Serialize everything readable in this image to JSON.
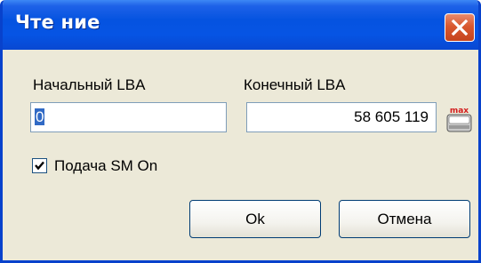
{
  "window": {
    "title": "Чте ние"
  },
  "start_lba": {
    "label": "Начальный LBA",
    "value": "0"
  },
  "end_lba": {
    "label": "Конечный LBA",
    "value": "58 605 119"
  },
  "max_button": {
    "icon": "max-icon",
    "text": "max"
  },
  "sm_checkbox": {
    "label": "Подача SM On",
    "checked": true
  },
  "buttons": {
    "ok": "Ok",
    "cancel": "Отмена"
  },
  "colors": {
    "titlebar": "#0553e0",
    "window_bg": "#ece9d8",
    "close_button": "#d9582f",
    "selection": "#316ac5"
  }
}
